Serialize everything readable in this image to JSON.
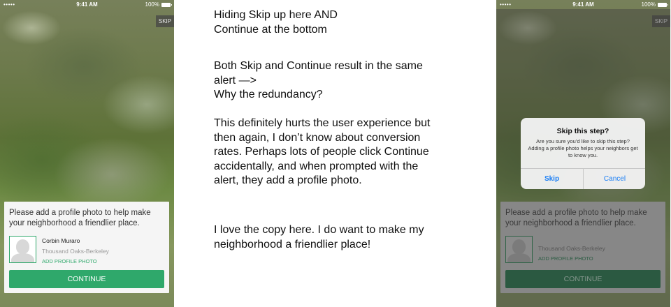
{
  "left_screen": {
    "status": {
      "signal": "•••••",
      "time": "9:41 AM",
      "battery": "100%"
    },
    "skip_label": "SKIP",
    "card": {
      "message": "Please add a profile photo to help make your neighborhood a friendlier place.",
      "user_name": "Corbin Muraro",
      "location": "Thousand Oaks-Berkeley",
      "add_photo_label": "ADD PROFILE PHOTO",
      "continue_label": "CONTINUE"
    }
  },
  "notes": [
    {
      "lines": [
        "Hiding Skip up here AND",
        "Continue at the bottom"
      ]
    },
    {
      "lines": [
        "Both Skip and Continue result in the same",
        "alert —>",
        "Why the redundancy?"
      ]
    },
    {
      "lines": [
        "This definitely hurts the user experience but",
        "then again, I don’t know about conversion",
        "rates. Perhaps lots of people click Continue",
        "accidentally, and when prompted with the",
        "alert, they add a profile photo."
      ]
    },
    {
      "lines": [
        "I love the copy here. I do want to make my",
        "neighborhood a friendlier place!"
      ]
    }
  ],
  "right_screen": {
    "status": {
      "signal": "•••••",
      "time": "9:41 AM",
      "battery": "100%"
    },
    "skip_label": "SKIP",
    "card": {
      "message": "Please add a profile photo to help make your neighborhood a friendlier place.",
      "location": "Thousand Oaks-Berkeley",
      "add_photo_label": "ADD PROFILE PHOTO",
      "continue_label": "CONTINUE"
    },
    "alert": {
      "title": "Skip this step?",
      "message": "Are you sure you’d like to skip this step? Adding a profile photo helps your neighbors get to know you.",
      "skip_label": "Skip",
      "cancel_label": "Cancel"
    }
  },
  "colors": {
    "accent": "#2fa86b",
    "alert_button": "#1a7ef5"
  },
  "icons": [
    "wifi-icon",
    "battery-icon",
    "avatar-placeholder-icon"
  ]
}
